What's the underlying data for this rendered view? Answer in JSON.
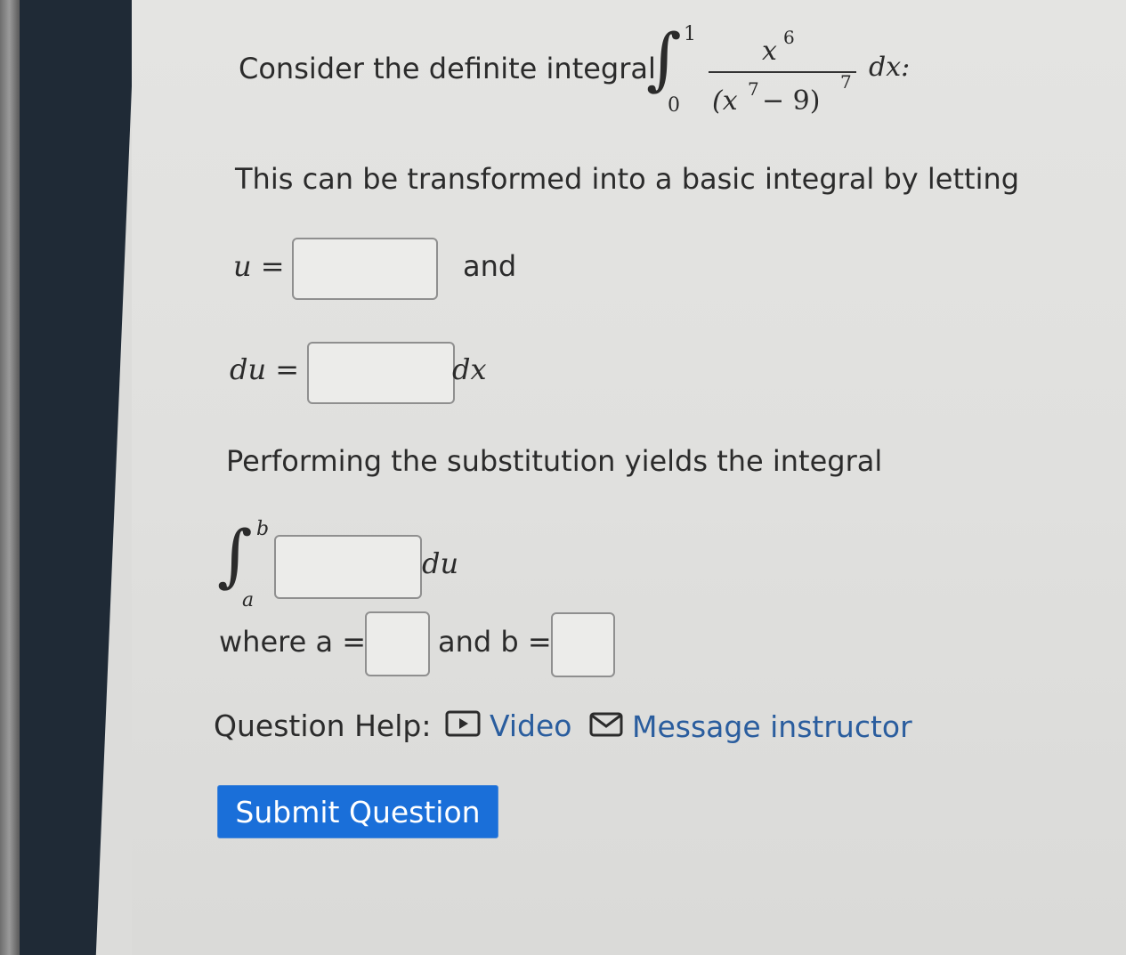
{
  "question": {
    "intro": "Consider the definite integral",
    "integral": {
      "lower": "0",
      "upper": "1",
      "numerator_base": "x",
      "numerator_exp": "6",
      "denominator_open": "(x",
      "denominator_inner_exp": "7",
      "denominator_rest": " − 9)",
      "denominator_exp": "7",
      "differential": "dx:"
    },
    "transform_text": "This can be transformed into a basic integral by letting",
    "u_label": "u =",
    "and_label": "and",
    "du_label": "du =",
    "dx_label": "dx",
    "substitution_text": "Performing the substitution yields the integral",
    "new_integral": {
      "lower": "a",
      "upper": "b",
      "differential": "du"
    },
    "where_a_label": "where a =",
    "and_b_label": "and b ="
  },
  "inputs": {
    "u_value": "",
    "du_value": "",
    "integrand_value": "",
    "a_value": "",
    "b_value": ""
  },
  "help": {
    "label": "Question Help:",
    "video_label": "Video",
    "video_icon": "video-play-icon",
    "message_label": "Message instructor",
    "message_icon": "envelope-icon"
  },
  "submit_label": "Submit Question",
  "colors": {
    "link": "#2a5d9e",
    "button": "#1a6fd9"
  }
}
